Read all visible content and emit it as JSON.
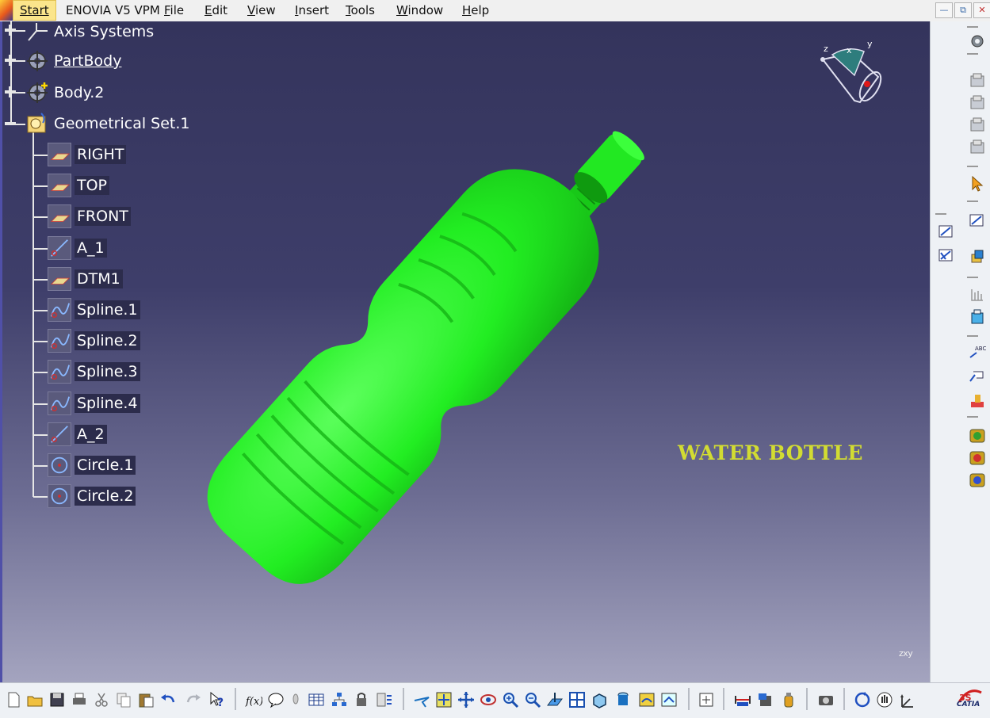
{
  "menu": {
    "start": "Start",
    "items": [
      {
        "label": "ENOVIA V5 VPM",
        "key": ""
      },
      {
        "label": "File",
        "key": "F"
      },
      {
        "label": "Edit",
        "key": "E"
      },
      {
        "label": "View",
        "key": "V"
      },
      {
        "label": "Insert",
        "key": "I"
      },
      {
        "label": "Tools",
        "key": "T"
      },
      {
        "label": "Window",
        "key": "W"
      },
      {
        "label": "Help",
        "key": "H"
      }
    ]
  },
  "window_controls": [
    "minimize-icon",
    "restore-icon",
    "close-icon"
  ],
  "tree": {
    "top_nodes": [
      {
        "label": "Axis Systems",
        "icon": "axis-system-icon",
        "expander": "plus"
      },
      {
        "label": "PartBody",
        "icon": "partbody-gear-icon",
        "expander": "plus",
        "underlined": true
      },
      {
        "label": "Body.2",
        "icon": "body-gear-icon",
        "expander": "plus"
      },
      {
        "label": "Geometrical Set.1",
        "icon": "geometrical-set-icon",
        "expander": "minus"
      }
    ],
    "children": [
      {
        "label": "RIGHT",
        "icon": "plane-icon"
      },
      {
        "label": "TOP",
        "icon": "plane-icon"
      },
      {
        "label": "FRONT",
        "icon": "plane-icon"
      },
      {
        "label": "A_1",
        "icon": "line-icon"
      },
      {
        "label": "DTM1",
        "icon": "plane-icon"
      },
      {
        "label": "Spline.1",
        "icon": "spline-icon"
      },
      {
        "label": "Spline.2",
        "icon": "spline-icon"
      },
      {
        "label": "Spline.3",
        "icon": "spline-icon"
      },
      {
        "label": "Spline.4",
        "icon": "spline-icon"
      },
      {
        "label": "A_2",
        "icon": "line-icon"
      },
      {
        "label": "Circle.1",
        "icon": "circle-icon"
      },
      {
        "label": "Circle.2",
        "icon": "circle-icon"
      }
    ]
  },
  "viewport": {
    "annotation": "WATER BOTTLE",
    "compass_labels": {
      "z": "z",
      "x": "x",
      "y": "y"
    },
    "mini_axis_label": "z x y"
  },
  "colors": {
    "bottle": "#22ee22",
    "annotation": "#d2dc32",
    "background_top": "#34345c",
    "background_bottom": "#a4a4bf"
  },
  "brand": "CATIA",
  "right_toolbar": [
    "sketcher-icon",
    "part-design-1-icon",
    "part-design-2-icon",
    "part-design-3-icon",
    "part-design-4-icon",
    "select-arrow-icon",
    "sketch-icon",
    "pad-icon",
    "grid-icon",
    "box-icon",
    "abc-annotation-icon",
    "flag-icon",
    "paint-icon",
    "analysis-1-icon",
    "analysis-2-icon",
    "analysis-3-icon",
    "sketch-left-1-icon",
    "sketch-left-2-icon"
  ],
  "bottom_toolbar": [
    "new-icon",
    "open-icon",
    "save-icon",
    "print-icon",
    "cut-icon",
    "copy-icon",
    "paste-icon",
    "undo-icon",
    "redo-icon",
    "whats-this-icon",
    "formula-icon",
    "comment-icon",
    "light-icon",
    "table-icon",
    "tree-icon",
    "lock-icon",
    "bars-icon",
    "fly-icon",
    "fit-all-icon",
    "pan-icon",
    "rotate-icon",
    "zoom-in-icon",
    "zoom-out-icon",
    "normal-view-icon",
    "multi-view-icon",
    "iso-view-icon",
    "shading-icon",
    "hide-show-icon",
    "swap-icon",
    "snapshot-icon",
    "measure-icon",
    "apply-material-icon",
    "material-bottle-icon",
    "camera-icon",
    "refresh-icon",
    "hand-icon",
    "axis-icon"
  ]
}
